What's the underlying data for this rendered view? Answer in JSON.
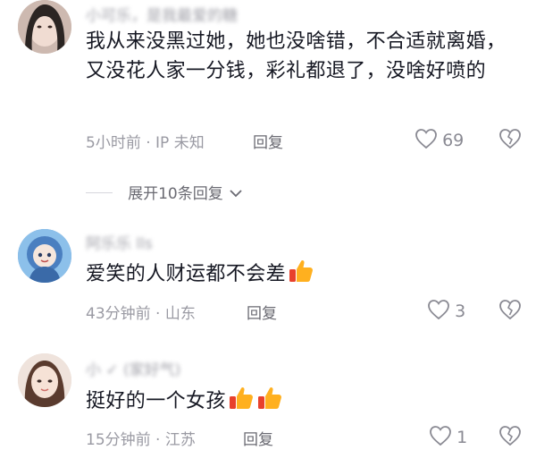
{
  "comments": [
    {
      "username": "小可乐，是我最爱的糖",
      "text": "我从来没黑过她，她也没啥错，不合适就离婚，又没花人家一分钱，彩礼都退了，没啥好喷的",
      "time": "5小时前",
      "location": "IP 未知",
      "reply_label": "回复",
      "likes": "69",
      "avatar_icon": "avatar-photo-icon"
    },
    {
      "username": "阿乐乐 lls",
      "text": "爱笑的人财运都不会差",
      "time": "43分钟前",
      "location": "山东",
      "reply_label": "回复",
      "likes": "3",
      "avatar_icon": "avatar-cartoon-icon",
      "emoji": [
        "thumbs-up-icon"
      ]
    },
    {
      "username": "小 ✓ (家好气)",
      "text": "挺好的一个女孩",
      "time": "15分钟前",
      "location": "江苏",
      "reply_label": "回复",
      "likes": "1",
      "avatar_icon": "avatar-photo-icon",
      "emoji": [
        "thumbs-up-icon",
        "thumbs-up-icon"
      ]
    }
  ],
  "expand_replies": {
    "label": "展开10条回复"
  },
  "colors": {
    "text": "#161823",
    "meta": "#9a9aa3",
    "accent_thumb": "#ffb01f"
  },
  "meta_separator": "·"
}
